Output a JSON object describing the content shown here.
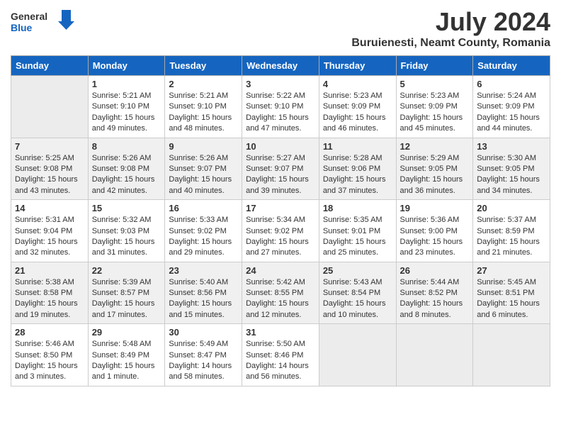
{
  "header": {
    "logo_general": "General",
    "logo_blue": "Blue",
    "month_year": "July 2024",
    "location": "Buruienesti, Neamt County, Romania"
  },
  "weekdays": [
    "Sunday",
    "Monday",
    "Tuesday",
    "Wednesday",
    "Thursday",
    "Friday",
    "Saturday"
  ],
  "weeks": [
    [
      {
        "day": "",
        "info": ""
      },
      {
        "day": "1",
        "info": "Sunrise: 5:21 AM\nSunset: 9:10 PM\nDaylight: 15 hours\nand 49 minutes."
      },
      {
        "day": "2",
        "info": "Sunrise: 5:21 AM\nSunset: 9:10 PM\nDaylight: 15 hours\nand 48 minutes."
      },
      {
        "day": "3",
        "info": "Sunrise: 5:22 AM\nSunset: 9:10 PM\nDaylight: 15 hours\nand 47 minutes."
      },
      {
        "day": "4",
        "info": "Sunrise: 5:23 AM\nSunset: 9:09 PM\nDaylight: 15 hours\nand 46 minutes."
      },
      {
        "day": "5",
        "info": "Sunrise: 5:23 AM\nSunset: 9:09 PM\nDaylight: 15 hours\nand 45 minutes."
      },
      {
        "day": "6",
        "info": "Sunrise: 5:24 AM\nSunset: 9:09 PM\nDaylight: 15 hours\nand 44 minutes."
      }
    ],
    [
      {
        "day": "7",
        "info": "Sunrise: 5:25 AM\nSunset: 9:08 PM\nDaylight: 15 hours\nand 43 minutes."
      },
      {
        "day": "8",
        "info": "Sunrise: 5:26 AM\nSunset: 9:08 PM\nDaylight: 15 hours\nand 42 minutes."
      },
      {
        "day": "9",
        "info": "Sunrise: 5:26 AM\nSunset: 9:07 PM\nDaylight: 15 hours\nand 40 minutes."
      },
      {
        "day": "10",
        "info": "Sunrise: 5:27 AM\nSunset: 9:07 PM\nDaylight: 15 hours\nand 39 minutes."
      },
      {
        "day": "11",
        "info": "Sunrise: 5:28 AM\nSunset: 9:06 PM\nDaylight: 15 hours\nand 37 minutes."
      },
      {
        "day": "12",
        "info": "Sunrise: 5:29 AM\nSunset: 9:05 PM\nDaylight: 15 hours\nand 36 minutes."
      },
      {
        "day": "13",
        "info": "Sunrise: 5:30 AM\nSunset: 9:05 PM\nDaylight: 15 hours\nand 34 minutes."
      }
    ],
    [
      {
        "day": "14",
        "info": "Sunrise: 5:31 AM\nSunset: 9:04 PM\nDaylight: 15 hours\nand 32 minutes."
      },
      {
        "day": "15",
        "info": "Sunrise: 5:32 AM\nSunset: 9:03 PM\nDaylight: 15 hours\nand 31 minutes."
      },
      {
        "day": "16",
        "info": "Sunrise: 5:33 AM\nSunset: 9:02 PM\nDaylight: 15 hours\nand 29 minutes."
      },
      {
        "day": "17",
        "info": "Sunrise: 5:34 AM\nSunset: 9:02 PM\nDaylight: 15 hours\nand 27 minutes."
      },
      {
        "day": "18",
        "info": "Sunrise: 5:35 AM\nSunset: 9:01 PM\nDaylight: 15 hours\nand 25 minutes."
      },
      {
        "day": "19",
        "info": "Sunrise: 5:36 AM\nSunset: 9:00 PM\nDaylight: 15 hours\nand 23 minutes."
      },
      {
        "day": "20",
        "info": "Sunrise: 5:37 AM\nSunset: 8:59 PM\nDaylight: 15 hours\nand 21 minutes."
      }
    ],
    [
      {
        "day": "21",
        "info": "Sunrise: 5:38 AM\nSunset: 8:58 PM\nDaylight: 15 hours\nand 19 minutes."
      },
      {
        "day": "22",
        "info": "Sunrise: 5:39 AM\nSunset: 8:57 PM\nDaylight: 15 hours\nand 17 minutes."
      },
      {
        "day": "23",
        "info": "Sunrise: 5:40 AM\nSunset: 8:56 PM\nDaylight: 15 hours\nand 15 minutes."
      },
      {
        "day": "24",
        "info": "Sunrise: 5:42 AM\nSunset: 8:55 PM\nDaylight: 15 hours\nand 12 minutes."
      },
      {
        "day": "25",
        "info": "Sunrise: 5:43 AM\nSunset: 8:54 PM\nDaylight: 15 hours\nand 10 minutes."
      },
      {
        "day": "26",
        "info": "Sunrise: 5:44 AM\nSunset: 8:52 PM\nDaylight: 15 hours\nand 8 minutes."
      },
      {
        "day": "27",
        "info": "Sunrise: 5:45 AM\nSunset: 8:51 PM\nDaylight: 15 hours\nand 6 minutes."
      }
    ],
    [
      {
        "day": "28",
        "info": "Sunrise: 5:46 AM\nSunset: 8:50 PM\nDaylight: 15 hours\nand 3 minutes."
      },
      {
        "day": "29",
        "info": "Sunrise: 5:48 AM\nSunset: 8:49 PM\nDaylight: 15 hours\nand 1 minute."
      },
      {
        "day": "30",
        "info": "Sunrise: 5:49 AM\nSunset: 8:47 PM\nDaylight: 14 hours\nand 58 minutes."
      },
      {
        "day": "31",
        "info": "Sunrise: 5:50 AM\nSunset: 8:46 PM\nDaylight: 14 hours\nand 56 minutes."
      },
      {
        "day": "",
        "info": ""
      },
      {
        "day": "",
        "info": ""
      },
      {
        "day": "",
        "info": ""
      }
    ]
  ]
}
